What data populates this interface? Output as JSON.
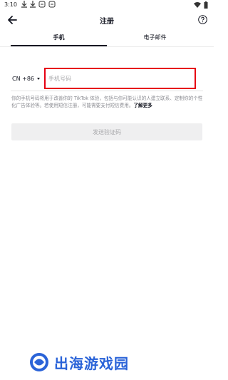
{
  "status_bar": {
    "time": "3:10"
  },
  "header": {
    "title": "注册"
  },
  "tabs": [
    {
      "label": "手机",
      "active": true
    },
    {
      "label": "电子邮件",
      "active": false
    }
  ],
  "phone": {
    "country_code": "CN +86",
    "placeholder": "手机号码",
    "value": ""
  },
  "info": {
    "text": "你的手机号码将用于改善你的 TikTok 体验，包括与你可能认识的人建立联系、定制你的个性化广告体验等。若使用短信注册，可能需要支付短信费用。",
    "learn_more": "了解更多"
  },
  "send_button": {
    "label": "发送验证码"
  },
  "watermark": {
    "text": "出海游戏园"
  },
  "colors": {
    "highlight": "#e60012",
    "disabled_bg": "#efeff0",
    "watermark": "#2a63d8"
  }
}
